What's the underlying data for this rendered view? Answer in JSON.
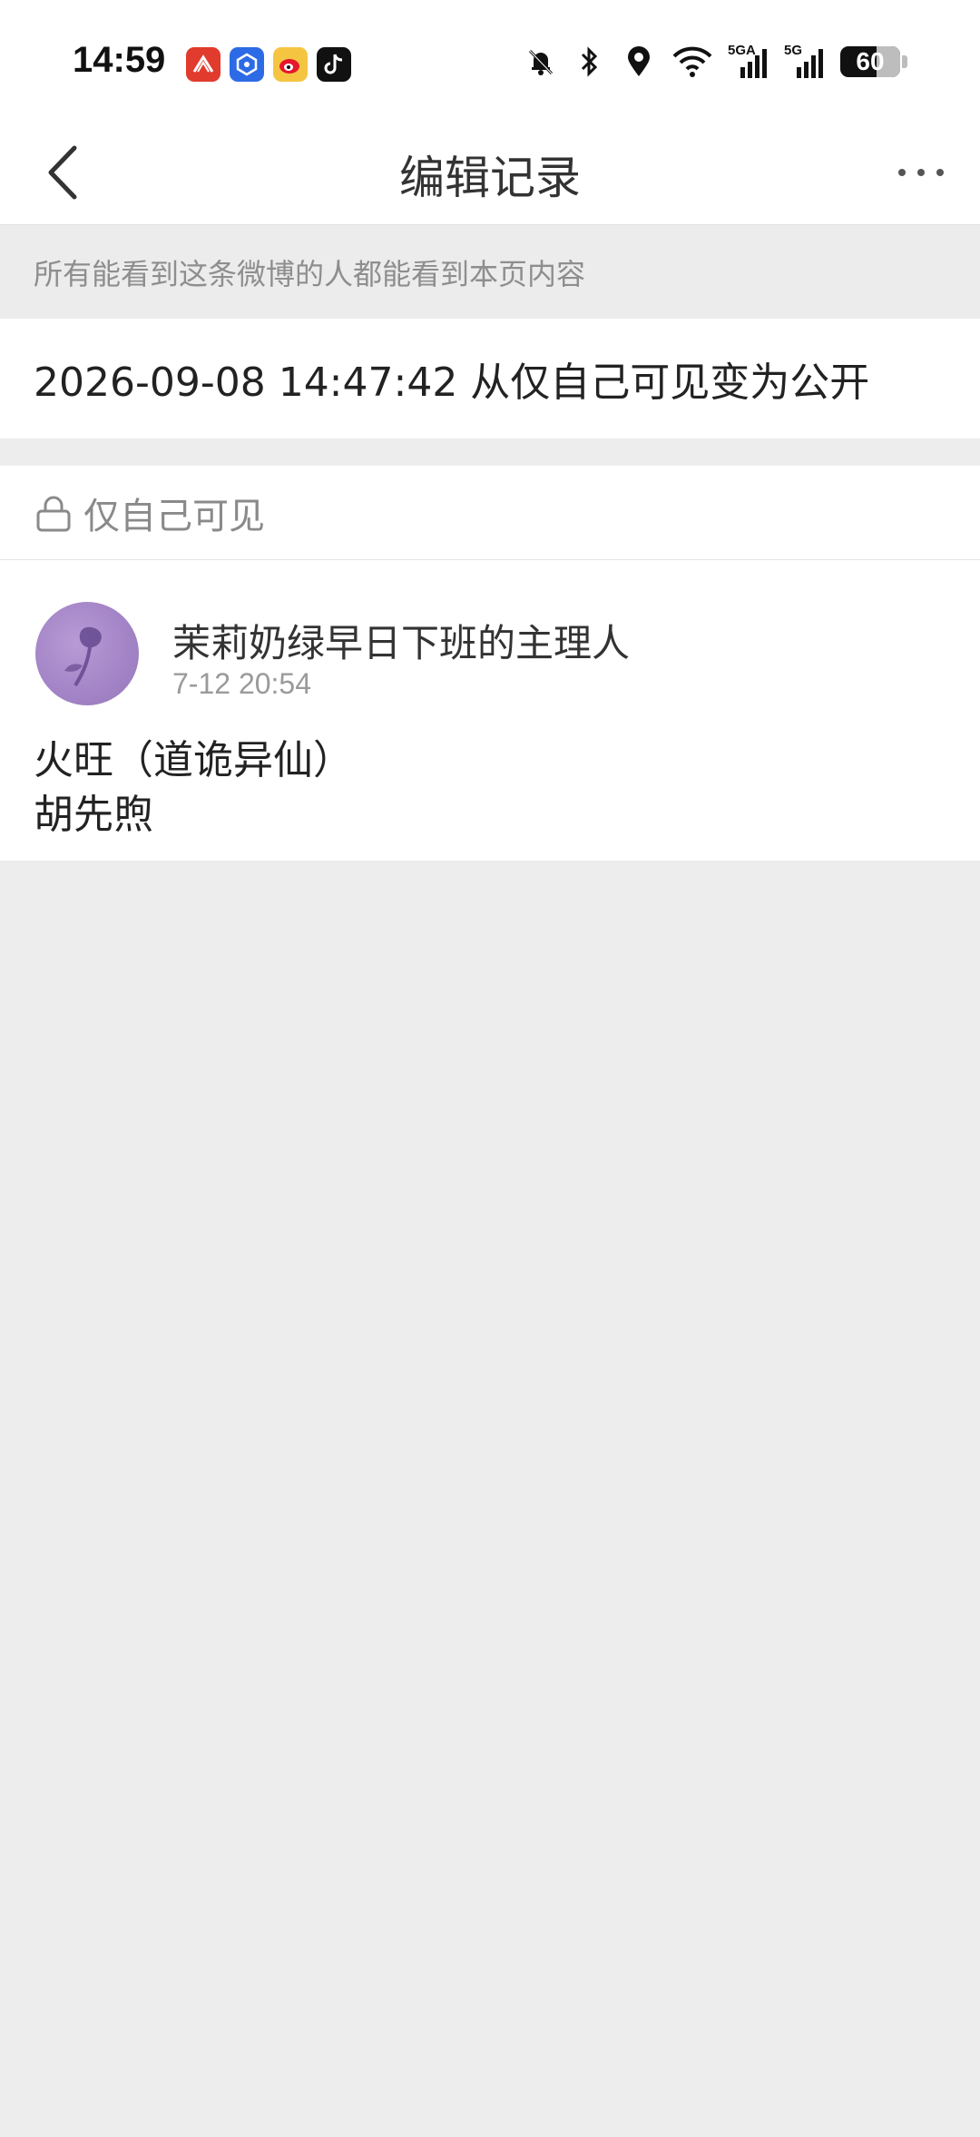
{
  "status_bar": {
    "time": "14:59",
    "apps": [
      {
        "icon": "chaoxing-app-icon",
        "color": "#e03b2d"
      },
      {
        "icon": "app-store-icon",
        "color": "#2d6be6"
      },
      {
        "icon": "weibo-app-icon",
        "color": "#f5c542"
      },
      {
        "icon": "tiktok-app-icon",
        "color": "#111111"
      }
    ],
    "net_label_1": "5GA",
    "net_label_2": "5G",
    "battery": "60"
  },
  "nav": {
    "title": "编辑记录"
  },
  "notice": "所有能看到这条微博的人都能看到本页内容",
  "record": "2026-09-08 14:47:42 从仅自己可见变为公开",
  "post": {
    "visibility": "仅自己可见",
    "author": "茉莉奶绿早日下班的主理人",
    "time": "7-12 20:54",
    "body_line_1": "火旺（道诡异仙）",
    "body_line_2": "胡先煦"
  },
  "colors": {
    "page_bg": "#ededed",
    "card_bg": "#ffffff",
    "muted_text": "#8e8e8e",
    "avatar": "#a485c7"
  }
}
